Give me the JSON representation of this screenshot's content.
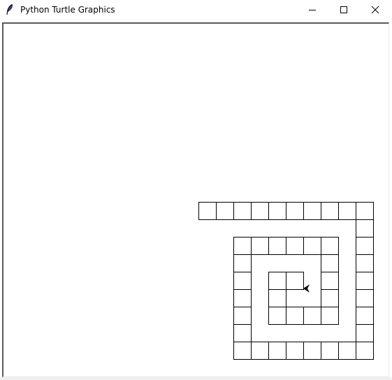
{
  "window": {
    "title": "Python Turtle Graphics",
    "app_icon": "feather-icon",
    "controls": [
      {
        "name": "minimize",
        "icon": "minimize-icon"
      },
      {
        "name": "maximize",
        "icon": "maximize-icon"
      },
      {
        "name": "close",
        "icon": "close-icon"
      }
    ]
  },
  "canvas": {
    "background": "#ffffff",
    "stroke_color": "#000000",
    "turtle_color": "#000000",
    "turtle_heading": "left"
  }
}
